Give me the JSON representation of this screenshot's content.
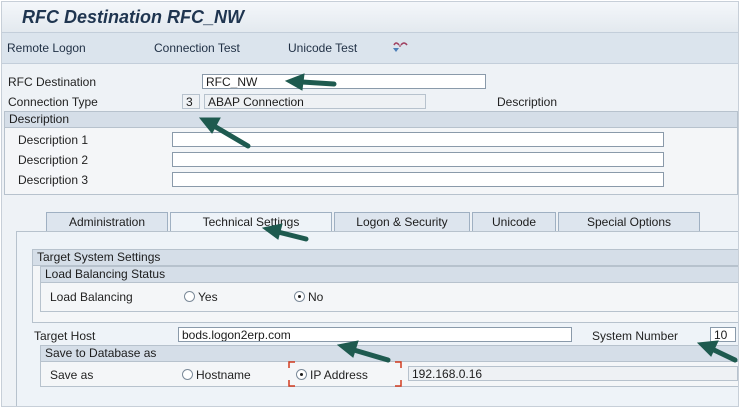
{
  "title": "RFC Destination RFC_NW",
  "toolbar": {
    "remote_logon": "Remote Logon",
    "connection_test": "Connection Test",
    "unicode_test": "Unicode Test",
    "icon": "glasses-icon"
  },
  "header": {
    "rfc_destination_label": "RFC Destination",
    "rfc_destination_value": "RFC_NW",
    "connection_type_label": "Connection Type",
    "connection_type_code": "3",
    "connection_type_value": "ABAP Connection",
    "description_label": "Description"
  },
  "description_group": {
    "title": "Description",
    "rows": [
      {
        "label": "Description 1",
        "value": ""
      },
      {
        "label": "Description 2",
        "value": ""
      },
      {
        "label": "Description 3",
        "value": ""
      }
    ]
  },
  "tabs": [
    {
      "label": "Administration",
      "active": false
    },
    {
      "label": "Technical Settings",
      "active": true
    },
    {
      "label": "Logon & Security",
      "active": false
    },
    {
      "label": "Unicode",
      "active": false
    },
    {
      "label": "Special Options",
      "active": false
    }
  ],
  "target_system": {
    "title": "Target System Settings",
    "load_balancing_status": {
      "title": "Load Balancing Status",
      "label": "Load Balancing",
      "options": [
        {
          "label": "Yes",
          "selected": false
        },
        {
          "label": "No",
          "selected": true
        }
      ]
    },
    "target_host_label": "Target Host",
    "target_host_value": "bods.logon2erp.com",
    "system_number_label": "System Number",
    "system_number_value": "10",
    "save_to_db": {
      "title": "Save to Database as",
      "label": "Save as",
      "options": [
        {
          "label": "Hostname",
          "selected": false
        },
        {
          "label": "IP Address",
          "selected": true
        }
      ],
      "ip_value": "192.168.0.16"
    }
  },
  "colors": {
    "arrow": "#1e5a4f",
    "title": "#1f3550",
    "toolbar_bg": "#dbe4ed"
  }
}
